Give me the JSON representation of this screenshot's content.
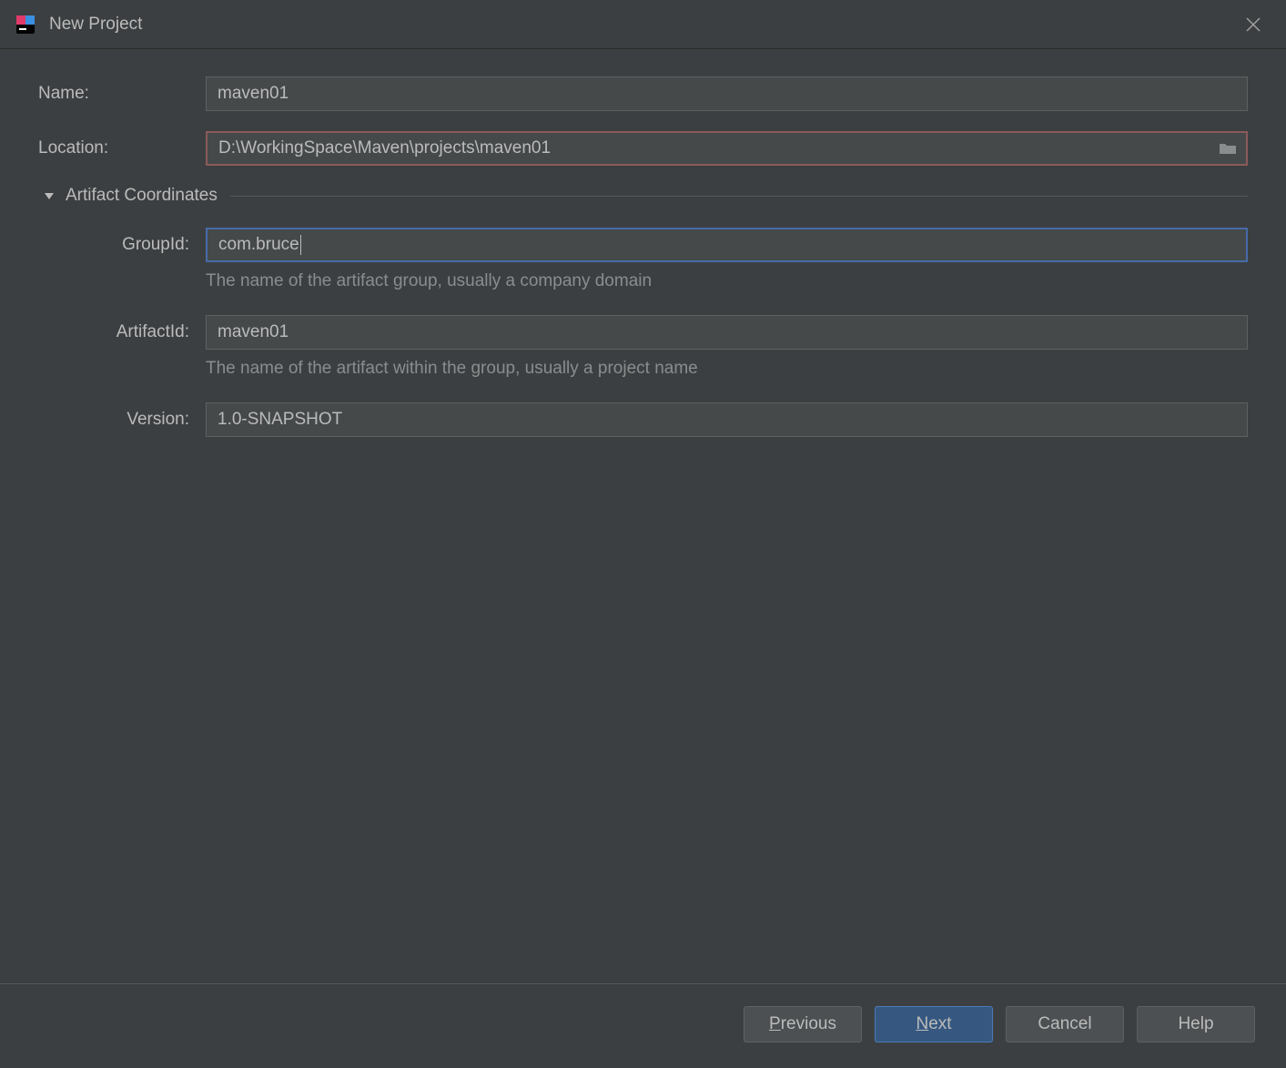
{
  "dialog": {
    "title": "New Project"
  },
  "form": {
    "name_label": "Name:",
    "name_value": "maven01",
    "location_label": "Location:",
    "location_value": "D:\\WorkingSpace\\Maven\\projects\\maven01",
    "artifact_section_title": "Artifact Coordinates",
    "groupid_label": "GroupId:",
    "groupid_value": "com.bruce",
    "groupid_hint": "The name of the artifact group, usually a company domain",
    "artifactid_label": "ArtifactId:",
    "artifactid_value": "maven01",
    "artifactid_hint": "The name of the artifact within the group, usually a project name",
    "version_label": "Version:",
    "version_value": "1.0-SNAPSHOT"
  },
  "buttons": {
    "previous_mnemonic": "P",
    "previous_rest": "revious",
    "next_mnemonic": "N",
    "next_rest": "ext",
    "cancel": "Cancel",
    "help": "Help"
  }
}
